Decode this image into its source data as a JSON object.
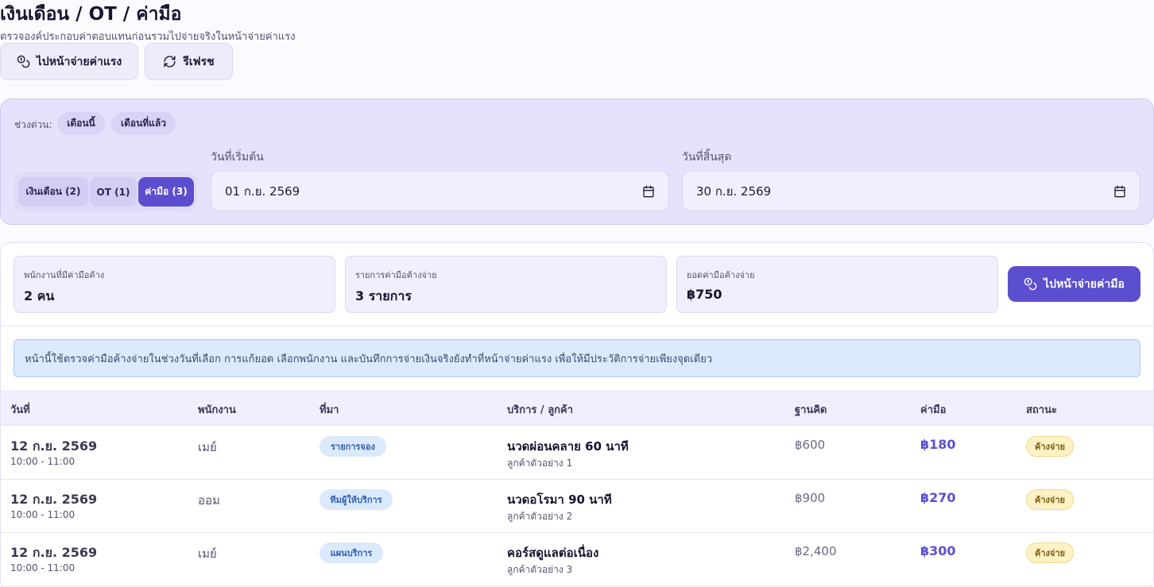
{
  "header": {
    "title": "เงินเดือน / OT / ค่ามือ",
    "subtitle": "ตรวจองค์ประกอบค่าตอบแทนก่อนรวมไปจ่ายจริงในหน้าจ่ายค่าแรง",
    "go_payroll_label": "ไปหน้าจ่ายค่าแรง",
    "refresh_label": "รีเฟรช"
  },
  "filters": {
    "quick_label": "ช่วงด่วน:",
    "quick_options": [
      "เดือนนี้",
      "เดือนที่แล้ว"
    ],
    "tabs": [
      {
        "label": "เงินเดือน (2)",
        "active": false
      },
      {
        "label": "OT (1)",
        "active": false
      },
      {
        "label": "ค่ามือ (3)",
        "active": true
      }
    ],
    "start_label": "วันที่เริ่มต้น",
    "start_value": "01 ก.ย. 2569",
    "end_label": "วันที่สิ้นสุด",
    "end_value": "30 ก.ย. 2569"
  },
  "summary": {
    "employees_label": "พนักงานที่มีค่ามือค้าง",
    "employees_value": "2 คน",
    "items_label": "รายการค่ามือค้างจ่าย",
    "items_value": "3 รายการ",
    "amount_label": "ยอดค่ามือค้างจ่าย",
    "amount_value": "฿750",
    "pay_button_label": "ไปหน้าจ่ายค่ามือ"
  },
  "notice": "หน้านี้ใช้ตรวจค่ามือค้างจ่ายในช่วงวันที่เลือก การแก้ยอด เลือกพนักงาน และบันทึกการจ่ายเงินจริงยังทำที่หน้าจ่ายค่าแรง เพื่อให้มีประวัติการจ่ายเพียงจุดเดียว",
  "table": {
    "headers": [
      "วันที่",
      "พนักงาน",
      "ที่มา",
      "บริการ / ลูกค้า",
      "ฐานคิด",
      "ค่ามือ",
      "สถานะ"
    ],
    "rows": [
      {
        "date": "12 ก.ย. 2569",
        "time": "10:00 - 11:00",
        "employee": "เมย์",
        "source": "รายการจอง",
        "service": "นวดผ่อนคลาย 60 นาที",
        "customer": "ลูกค้าตัวอย่าง 1",
        "base": "฿600",
        "commission": "฿180",
        "status": "ค้างจ่าย"
      },
      {
        "date": "12 ก.ย. 2569",
        "time": "10:00 - 11:00",
        "employee": "ออม",
        "source": "ทีมผู้ให้บริการ",
        "service": "นวดอโรมา 90 นาที",
        "customer": "ลูกค้าตัวอย่าง 2",
        "base": "฿900",
        "commission": "฿270",
        "status": "ค้างจ่าย"
      },
      {
        "date": "12 ก.ย. 2569",
        "time": "10:00 - 11:00",
        "employee": "เมย์",
        "source": "แผนบริการ",
        "service": "คอร์สดูแลต่อเนื่อง",
        "customer": "ลูกค้าตัวอย่าง 3",
        "base": "฿2,400",
        "commission": "฿300",
        "status": "ค้างจ่าย"
      }
    ]
  }
}
